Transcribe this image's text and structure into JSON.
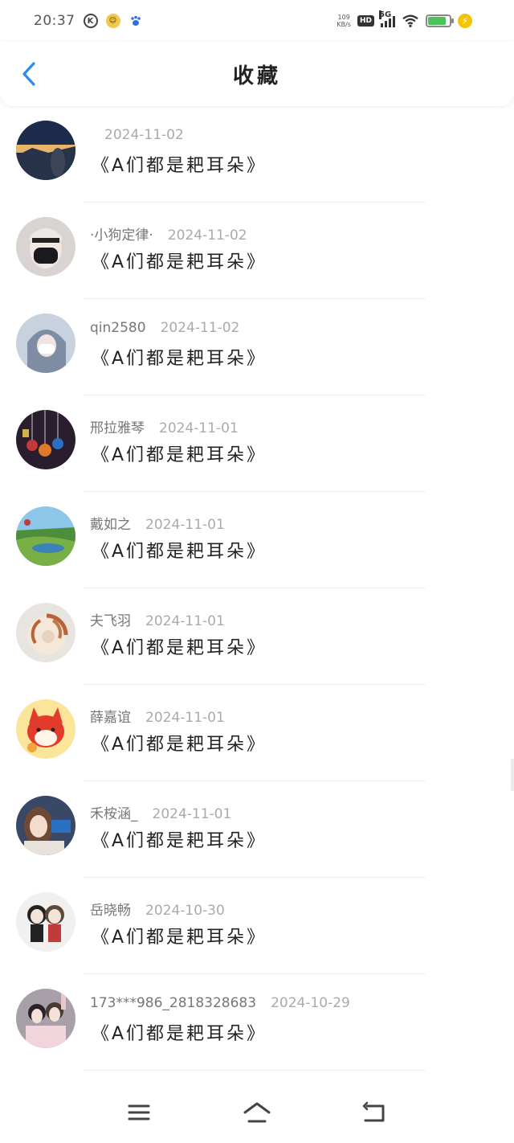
{
  "status_bar": {
    "time": "20:37",
    "net_speed_value": "109",
    "net_speed_unit": "KB/s",
    "hd_label": "HD",
    "signal_label": "5G",
    "battery_level": 0.85,
    "colors": {
      "battery": "#4cc35a",
      "charge": "#f5c400",
      "paw": "#2f6fe0"
    }
  },
  "header": {
    "title": "收藏",
    "accent_color": "#2a8bf2"
  },
  "favorites": [
    {
      "username": "",
      "date": "2024-11-02",
      "title": "《A们都是耙耳朵》",
      "avatar": "night-landscape"
    },
    {
      "username": "·小狗定律·",
      "date": "2024-11-02",
      "title": "《A们都是耙耳朵》",
      "avatar": "masked-person"
    },
    {
      "username": "qin2580",
      "date": "2024-11-02",
      "title": "《A们都是耙耳朵》",
      "avatar": "hooded-girl"
    },
    {
      "username": "邢拉雅琴",
      "date": "2024-11-01",
      "title": "《A们都是耙耳朵》",
      "avatar": "charms"
    },
    {
      "username": "戴如之",
      "date": "2024-11-01",
      "title": "《A们都是耙耳朵》",
      "avatar": "fields"
    },
    {
      "username": "夫飞羽",
      "date": "2024-11-01",
      "title": "《A们都是耙耳朵》",
      "avatar": "nautilus-shell"
    },
    {
      "username": "薛嘉谊",
      "date": "2024-11-01",
      "title": "《A们都是耙耳朵》",
      "avatar": "red-fox-cartoon"
    },
    {
      "username": "禾桉涵_",
      "date": "2024-11-01",
      "title": "《A们都是耙耳朵》",
      "avatar": "girl-selfie"
    },
    {
      "username": "岳晓畅",
      "date": "2024-10-30",
      "title": "《A们都是耙耳朵》",
      "avatar": "couple-dolls"
    },
    {
      "username": "173***986_2818328683",
      "date": "2024-10-29",
      "title": "《A们都是耙耳朵》",
      "avatar": "two-people"
    }
  ],
  "nav_bar": {
    "icons": [
      "menu-icon",
      "home-icon",
      "back-icon"
    ]
  }
}
